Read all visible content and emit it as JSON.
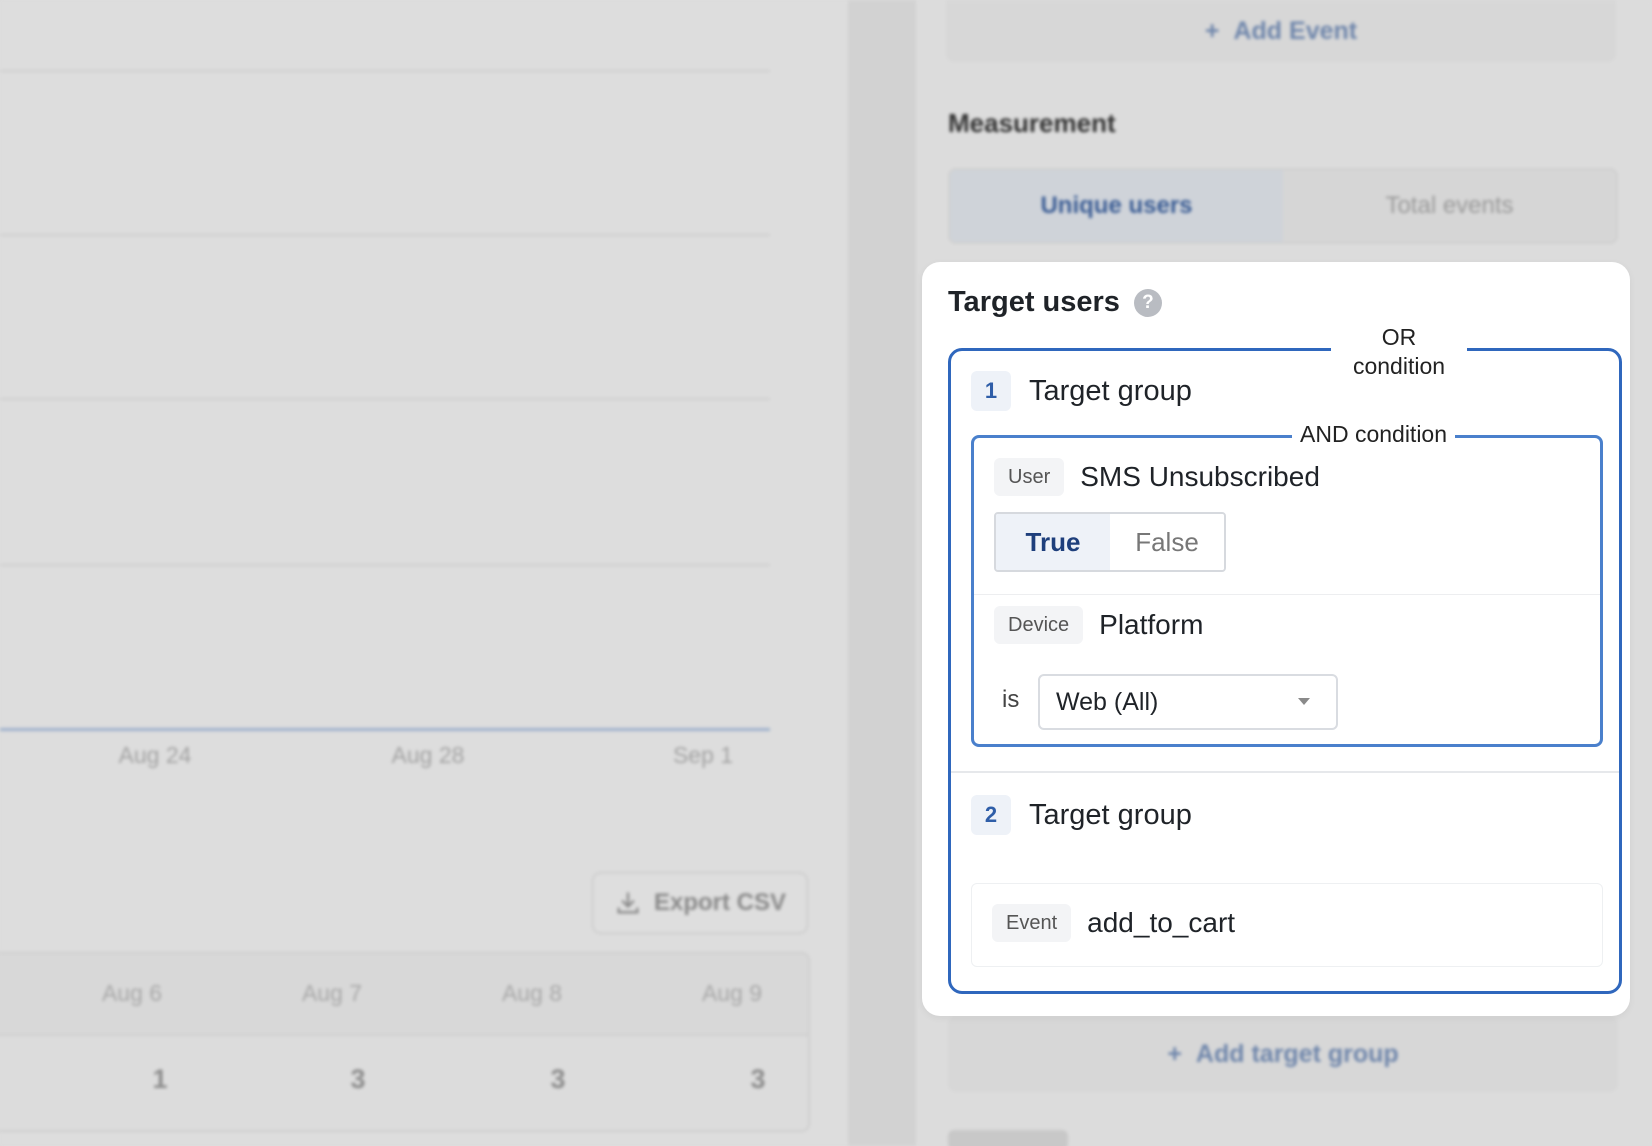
{
  "chart": {
    "x_ticks": [
      "Aug 24",
      "Aug 28",
      "Sep 1"
    ]
  },
  "export_label": "Export CSV",
  "table": {
    "headers": [
      "Aug 6",
      "Aug 7",
      "Aug 8",
      "Aug 9"
    ],
    "values": [
      "1",
      "3",
      "3",
      "3"
    ]
  },
  "add_event_label": "Add Event",
  "measurement": {
    "title": "Measurement",
    "options": [
      "Unique users",
      "Total events"
    ],
    "selected": "Unique users"
  },
  "target_users": {
    "title": "Target users",
    "help_glyph": "?",
    "or_label_line1": "OR",
    "or_label_line2": "condition",
    "groups": [
      {
        "number": "1",
        "title": "Target group",
        "and_label": "AND condition",
        "conditions": [
          {
            "category": "User",
            "property": "SMS Unsubscribed",
            "options": [
              "True",
              "False"
            ],
            "selected": "True"
          },
          {
            "category": "Device",
            "property": "Platform",
            "operator": "is",
            "value": "Web (All)"
          }
        ]
      },
      {
        "number": "2",
        "title": "Target group",
        "conditions": [
          {
            "category": "Event",
            "property": "add_to_cart"
          }
        ]
      }
    ]
  },
  "add_target_group_label": "Add target group",
  "colors": {
    "accent": "#2f67bd",
    "selected_text": "#1e3f7c"
  }
}
